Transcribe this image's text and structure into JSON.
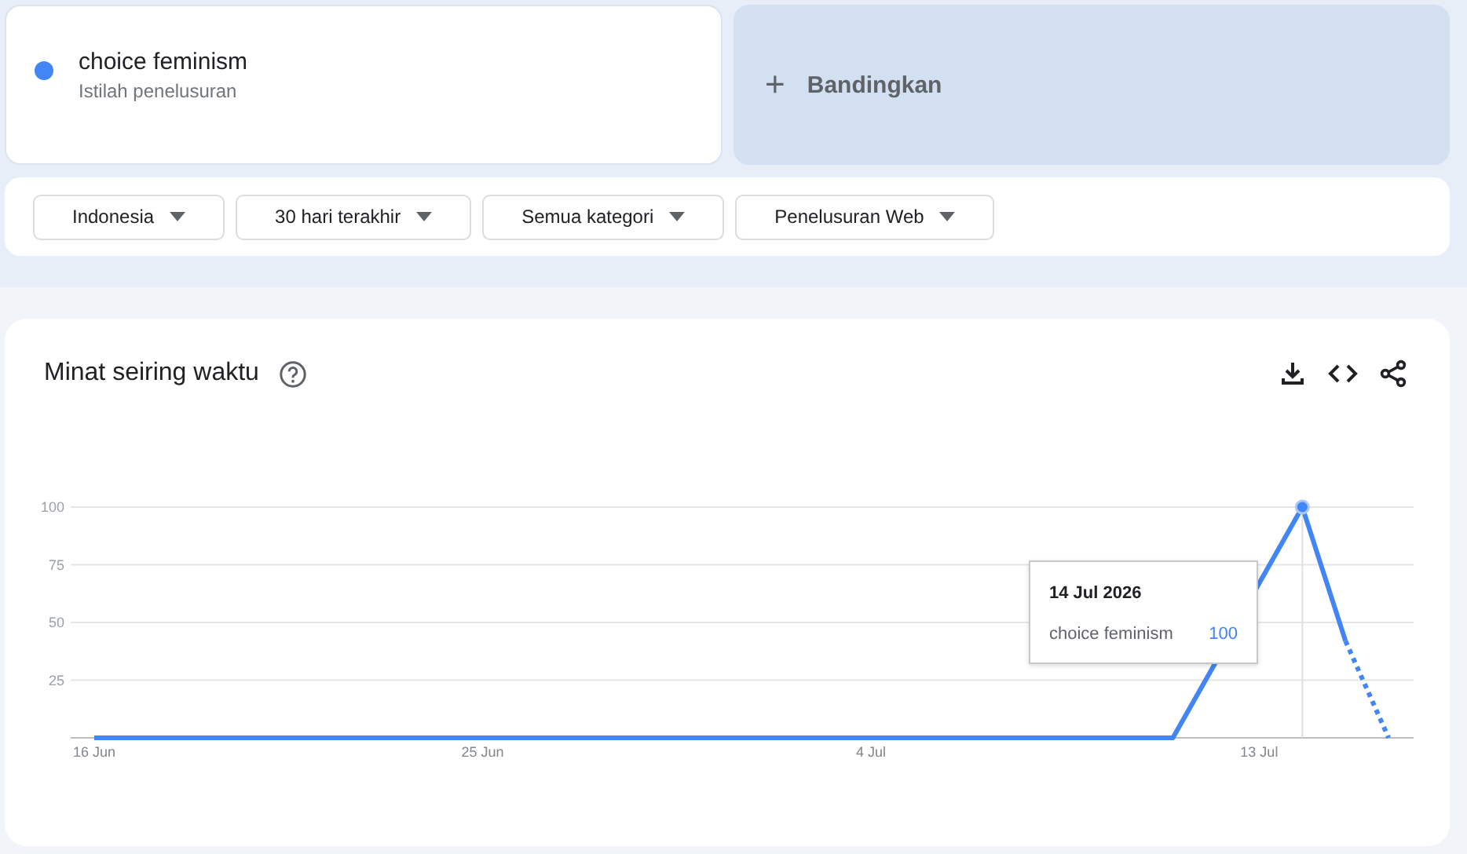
{
  "search_term": {
    "color": "#4285f4",
    "term": "choice feminism",
    "subtitle": "Istilah penelusuran"
  },
  "compare": {
    "icon": "+",
    "label": "Bandingkan"
  },
  "filters": [
    {
      "label": "Indonesia"
    },
    {
      "label": "30 hari terakhir"
    },
    {
      "label": "Semua kategori"
    },
    {
      "label": "Penelusuran Web"
    }
  ],
  "interest_card": {
    "title": "Minat seiring waktu",
    "chart_data": {
      "type": "line",
      "grid": true,
      "categories": [
        "16 Jun",
        null,
        null,
        null,
        null,
        null,
        null,
        null,
        null,
        "25 Jun",
        null,
        null,
        null,
        null,
        null,
        null,
        null,
        null,
        "4 Jul",
        null,
        null,
        null,
        null,
        null,
        null,
        null,
        null,
        "13 Jul",
        null,
        null,
        null
      ],
      "series": [
        {
          "name": "choice feminism",
          "color": "#4285f4",
          "values": [
            0,
            0,
            0,
            0,
            0,
            0,
            0,
            0,
            0,
            0,
            0,
            0,
            0,
            0,
            0,
            0,
            0,
            0,
            0,
            0,
            0,
            0,
            0,
            0,
            0,
            0,
            33,
            67,
            100,
            42,
            0
          ]
        }
      ],
      "ylim": [
        0,
        100
      ],
      "yticks": [
        25,
        50,
        75,
        100
      ]
    },
    "tooltip": {
      "date": "14 Jul 2026",
      "value": "100"
    }
  }
}
